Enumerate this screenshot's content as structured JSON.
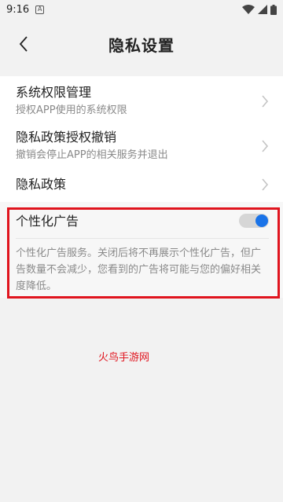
{
  "status_bar": {
    "time": "9:16",
    "notif_badge": "A",
    "icons": [
      "wifi-icon",
      "signal-icon",
      "battery-icon"
    ]
  },
  "header": {
    "title": "隐私设置",
    "back_icon": "chevron-left-icon"
  },
  "settings": {
    "items": [
      {
        "title": "系统权限管理",
        "subtitle": "授权APP使用的系统权限"
      },
      {
        "title": "隐私政策授权撤销",
        "subtitle": "撤销会停止APP的相关服务并退出"
      },
      {
        "title": "隐私政策"
      }
    ]
  },
  "personalized_ads": {
    "title": "个性化广告",
    "enabled": true,
    "description": "个性化广告服务。关闭后将不再展示个性化广告，但广告数量不会减少，您看到的广告将可能与您的偏好相关度降低。"
  },
  "watermark": "火鸟手游网",
  "colors": {
    "accent": "#1a73e8",
    "highlight": "#e0141e",
    "background": "#f2f2f2"
  }
}
